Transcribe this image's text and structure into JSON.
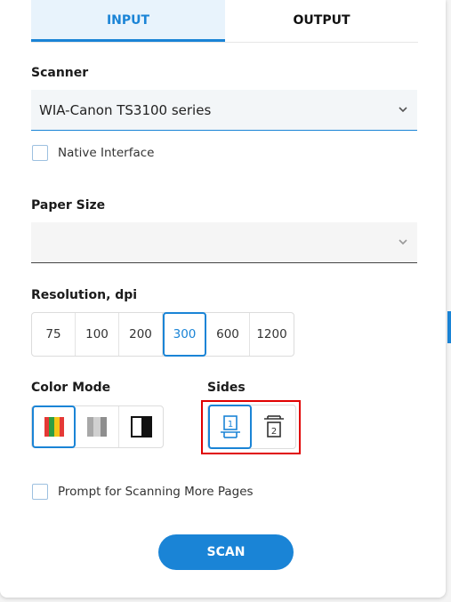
{
  "tabs": {
    "input": "INPUT",
    "output": "OUTPUT"
  },
  "scanner": {
    "label": "Scanner",
    "value": "WIA-Canon TS3100 series"
  },
  "native_interface": {
    "label": "Native Interface",
    "checked": false
  },
  "paper_size": {
    "label": "Paper Size",
    "value": ""
  },
  "resolution": {
    "label": "Resolution, dpi",
    "options": [
      "75",
      "100",
      "200",
      "300",
      "600",
      "1200"
    ],
    "selected": "300"
  },
  "color_mode": {
    "label": "Color Mode",
    "options": [
      "color",
      "grayscale",
      "black-and-white"
    ],
    "selected": "color"
  },
  "sides": {
    "label": "Sides",
    "options": [
      "single-side",
      "double-side"
    ],
    "selected": "single-side",
    "one": "1",
    "two": "2"
  },
  "prompt_more": {
    "label": "Prompt for Scanning More Pages",
    "checked": false
  },
  "scan_button": "SCAN",
  "colors": {
    "accent": "#1a84d6",
    "highlight": "#e00000"
  }
}
